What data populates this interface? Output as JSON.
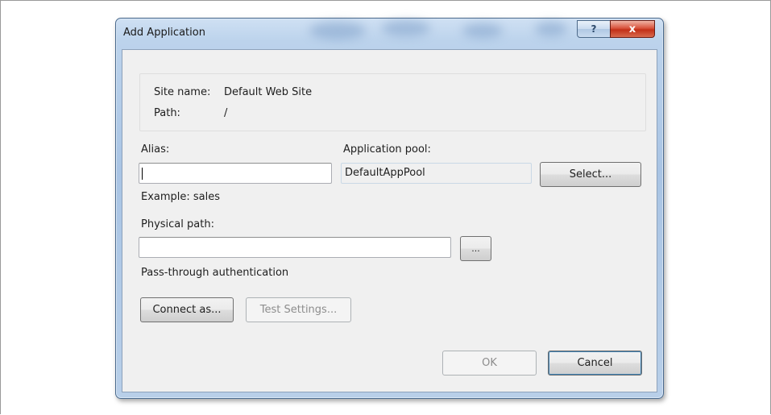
{
  "window": {
    "title": "Add Application",
    "help_glyph": "?",
    "close_glyph": "x"
  },
  "info": {
    "site_name_label": "Site name:",
    "site_name_value": "Default Web Site",
    "path_label": "Path:",
    "path_value": "/"
  },
  "alias": {
    "label": "Alias:",
    "value": "",
    "example": "Example: sales"
  },
  "app_pool": {
    "label": "Application pool:",
    "value": "DefaultAppPool",
    "select_label": "Select..."
  },
  "physical_path": {
    "label": "Physical path:",
    "value": "",
    "browse_label": "..."
  },
  "auth": {
    "label": "Pass-through authentication",
    "connect_as_label": "Connect as...",
    "test_settings_label": "Test Settings..."
  },
  "footer": {
    "ok_label": "OK",
    "cancel_label": "Cancel"
  },
  "colors": {
    "title_bar": "#b8cfe9",
    "close_button": "#c23018",
    "dialog_body": "#f0f0f0"
  }
}
